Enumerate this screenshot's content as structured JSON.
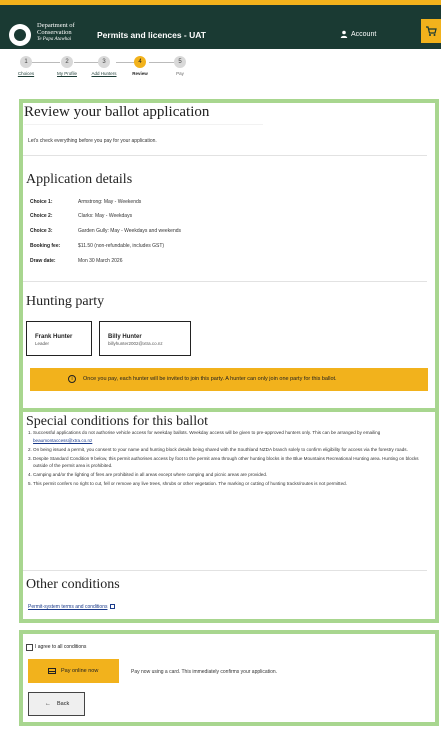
{
  "header": {
    "logo_line1": "Department of",
    "logo_line2": "Conservation",
    "logo_line3": "Te Papa Atawhai",
    "app_title": "Permits and licences - UAT",
    "account_label": "Account"
  },
  "steps": [
    {
      "number": "1",
      "label": "Choices"
    },
    {
      "number": "2",
      "label": "My Profile"
    },
    {
      "number": "3",
      "label": "Add Hunters"
    },
    {
      "number": "4",
      "label": "Review"
    },
    {
      "number": "5",
      "label": "Pay"
    }
  ],
  "review": {
    "title": "Review your ballot application",
    "intro": "Let's check everything before you pay for your application."
  },
  "application": {
    "title": "Application details",
    "rows": [
      {
        "label": "Choice 1:",
        "value": "Armstrong: May - Weekends"
      },
      {
        "label": "Choice 2:",
        "value": "Clarks: May - Weekdays"
      },
      {
        "label": "Choice 3:",
        "value": "Garden Gully: May - Weekdays and weekends"
      },
      {
        "label": "Booking fee:",
        "value": "$11.50 (non-refundable, includes GST)"
      },
      {
        "label": "Draw date:",
        "value": "Mon 30 March 2026"
      }
    ]
  },
  "party": {
    "title": "Hunting party",
    "hunters": [
      {
        "name": "Frank Hunter",
        "sub": "Leader"
      },
      {
        "name": "Billy Hunter",
        "sub": "billyhunter2002@xtra.co.nz"
      }
    ],
    "notice": "Once you pay, each hunter will be invited to join this party. A hunter can only join one party for this ballot."
  },
  "special": {
    "title": "Special conditions for this ballot",
    "items": [
      {
        "num": "1.",
        "text": "Successful applications do not authorise vehicle access for weekday ballots. Weekday access will be given to pre-approved hunters only. This can be arranged by emailing",
        "link": "beaumontaccess@xtra.co.nz"
      },
      {
        "num": "2.",
        "text": "On being issued a permit, you consent to your name and hunting block details being shared with the Southland NZDA branch solely to confirm eligibility for access via the forestry roads."
      },
      {
        "num": "3.",
        "text": "Despite Standard Condition 9 below, this permit authorises access by foot to the permit area through other hunting blocks in the Blue Mountains Recreational Hunting area. Hunting on blocks outside of the permit area is prohibited."
      },
      {
        "num": "4.",
        "text": "Camping and/or the lighting of fires are prohibited in all areas except where camping and picnic areas are provided."
      },
      {
        "num": "5.",
        "text": "This permit confers no right to cut, fell or remove any live trees, shrubs or other vegetation. The marking or cutting of hunting tracks/routes is not permitted."
      }
    ]
  },
  "other": {
    "title": "Other conditions",
    "link": "Permit-system terms and conditions"
  },
  "actions": {
    "agree_label": "I agree to all conditions",
    "pay_label": "Pay online now",
    "pay_help": "Pay now using a card. This immediately confirms your application.",
    "back_label": "Back"
  },
  "colors": {
    "header_bg": "#1a3a33",
    "accent": "#f2b21c",
    "panel_border": "#a8d68f"
  }
}
